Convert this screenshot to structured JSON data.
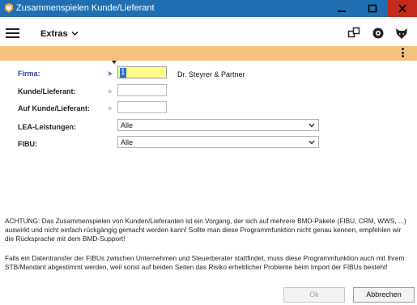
{
  "window": {
    "title": "Zusammenspielen Kunde/Lieferant"
  },
  "toolbar": {
    "menu_label": "Extras"
  },
  "form": {
    "firma": {
      "label": "Firma:",
      "value": "1",
      "name": "Dr. Steyrer & Partner"
    },
    "kunde_lieferant": {
      "label": "Kunde/Lieferant:",
      "value": ""
    },
    "auf_kunde_lieferant": {
      "label": "Auf Kunde/Lieferant:",
      "value": ""
    },
    "lea_leistungen": {
      "label": "LEA-Leistungen:",
      "value": "Alle"
    },
    "fibu": {
      "label": "FIBU:",
      "value": "Alle"
    }
  },
  "notes": {
    "warning": "ACHTUNG: Das Zusammenspielen von Kunden/Lieferanten ist ein Vorgang, der sich auf mehrere BMD-Pakete (FIBU, CRM, WWS, ...) auswirkt und nicht einfach rückgängig gemacht werden kann! Sollte man diese Programmfunktion nicht genau kennen, empfehlen wir die Rücksprache mit dem BMD-Support!",
    "datatransfer": "Falls ein Datentransfer der FIBUs zwischen Unternehmen und Steuerberater stattfindet, muss diese Programmfunktion auch mit Ihrem STB/Mandant abgestimmt werden, weil sonst auf beiden Seiten das Risiko erheblicher Probleme beim Import der FIBUs besteht!"
  },
  "buttons": {
    "ok": "Ok",
    "cancel": "Abbrechen"
  },
  "colors": {
    "titlebar": "#1f6fb2",
    "close_button": "#c42b1c",
    "strip": "#f4c27e",
    "firma_field": "#ffff88",
    "label_blue": "#2b3d9c"
  },
  "icons": [
    "app-icon",
    "minimize-icon",
    "maximize-icon",
    "close-icon",
    "hamburger-menu-icon",
    "chevron-down-icon",
    "window-arrange-icon",
    "help-icon",
    "fox-icon",
    "more-vertical-icon",
    "dropdown-arrow-icon"
  ]
}
